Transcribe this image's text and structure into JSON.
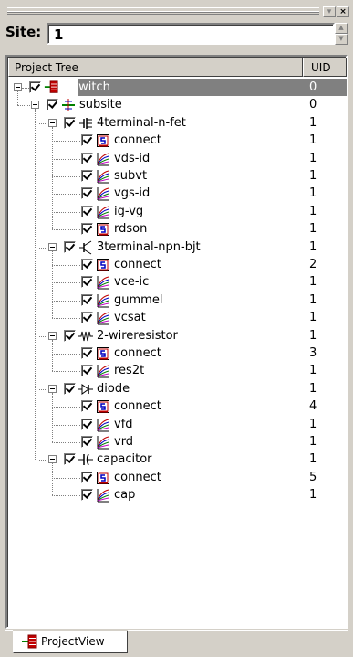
{
  "window": {
    "dropdown_btn": "▾",
    "close_btn": "×"
  },
  "site": {
    "label": "Site:",
    "value": "1"
  },
  "tree": {
    "columns": [
      "Project Tree",
      "UID"
    ],
    "root": {
      "label": "ivswitch",
      "uid": "0"
    },
    "subsite": {
      "label": "subsite",
      "uid": "0"
    },
    "devices": [
      {
        "label": "4terminal-n-fet",
        "uid": "1",
        "icon": "nfet-icon",
        "items": [
          {
            "label": "connect",
            "uid": "1",
            "icon": "connect-icon"
          },
          {
            "label": "vds-id",
            "uid": "1",
            "icon": "curve-icon"
          },
          {
            "label": "subvt",
            "uid": "1",
            "icon": "curve-icon"
          },
          {
            "label": "vgs-id",
            "uid": "1",
            "icon": "curve-icon"
          },
          {
            "label": "ig-vg",
            "uid": "1",
            "icon": "curve-icon"
          },
          {
            "label": "rdson",
            "uid": "1",
            "icon": "connect-icon"
          }
        ]
      },
      {
        "label": "3terminal-npn-bjt",
        "uid": "1",
        "icon": "bjt-icon",
        "items": [
          {
            "label": "connect",
            "uid": "2",
            "icon": "connect-icon"
          },
          {
            "label": "vce-ic",
            "uid": "1",
            "icon": "curve-icon"
          },
          {
            "label": "gummel",
            "uid": "1",
            "icon": "curve-icon"
          },
          {
            "label": "vcsat",
            "uid": "1",
            "icon": "curve-icon"
          }
        ]
      },
      {
        "label": "2-wireresistor",
        "uid": "1",
        "icon": "resistor-icon",
        "items": [
          {
            "label": "connect",
            "uid": "3",
            "icon": "connect-icon"
          },
          {
            "label": "res2t",
            "uid": "1",
            "icon": "curve-icon"
          }
        ]
      },
      {
        "label": "diode",
        "uid": "1",
        "icon": "diode-icon",
        "items": [
          {
            "label": "connect",
            "uid": "4",
            "icon": "connect-icon"
          },
          {
            "label": "vfd",
            "uid": "1",
            "icon": "curve-icon"
          },
          {
            "label": "vrd",
            "uid": "1",
            "icon": "curve-icon"
          }
        ]
      },
      {
        "label": "capacitor",
        "uid": "1",
        "icon": "capacitor-icon",
        "items": [
          {
            "label": "connect",
            "uid": "5",
            "icon": "connect-icon"
          },
          {
            "label": "cap",
            "uid": "1",
            "icon": "curve-icon"
          }
        ]
      }
    ]
  },
  "tab": {
    "label": "ProjectView"
  },
  "colors": {
    "face": "#d4d0c8",
    "selection": "#808080",
    "window": "#ffffff"
  }
}
